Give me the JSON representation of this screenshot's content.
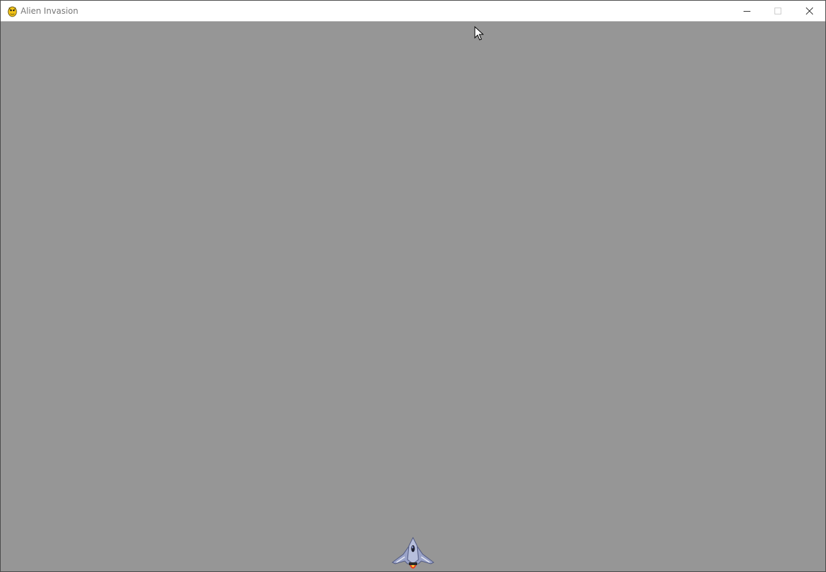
{
  "window": {
    "title": "Alien Invasion",
    "app_icon": "pygame-snake-icon",
    "controls": {
      "minimize_icon": "minimize-icon",
      "maximize_icon": "maximize-icon",
      "close_icon": "close-icon",
      "maximize_enabled": false
    }
  },
  "game": {
    "background_color": "#969696",
    "player_ship": {
      "icon": "spaceship-icon",
      "flame_color": "#e83a1c"
    }
  },
  "cursor": {
    "icon": "mouse-pointer-icon"
  }
}
